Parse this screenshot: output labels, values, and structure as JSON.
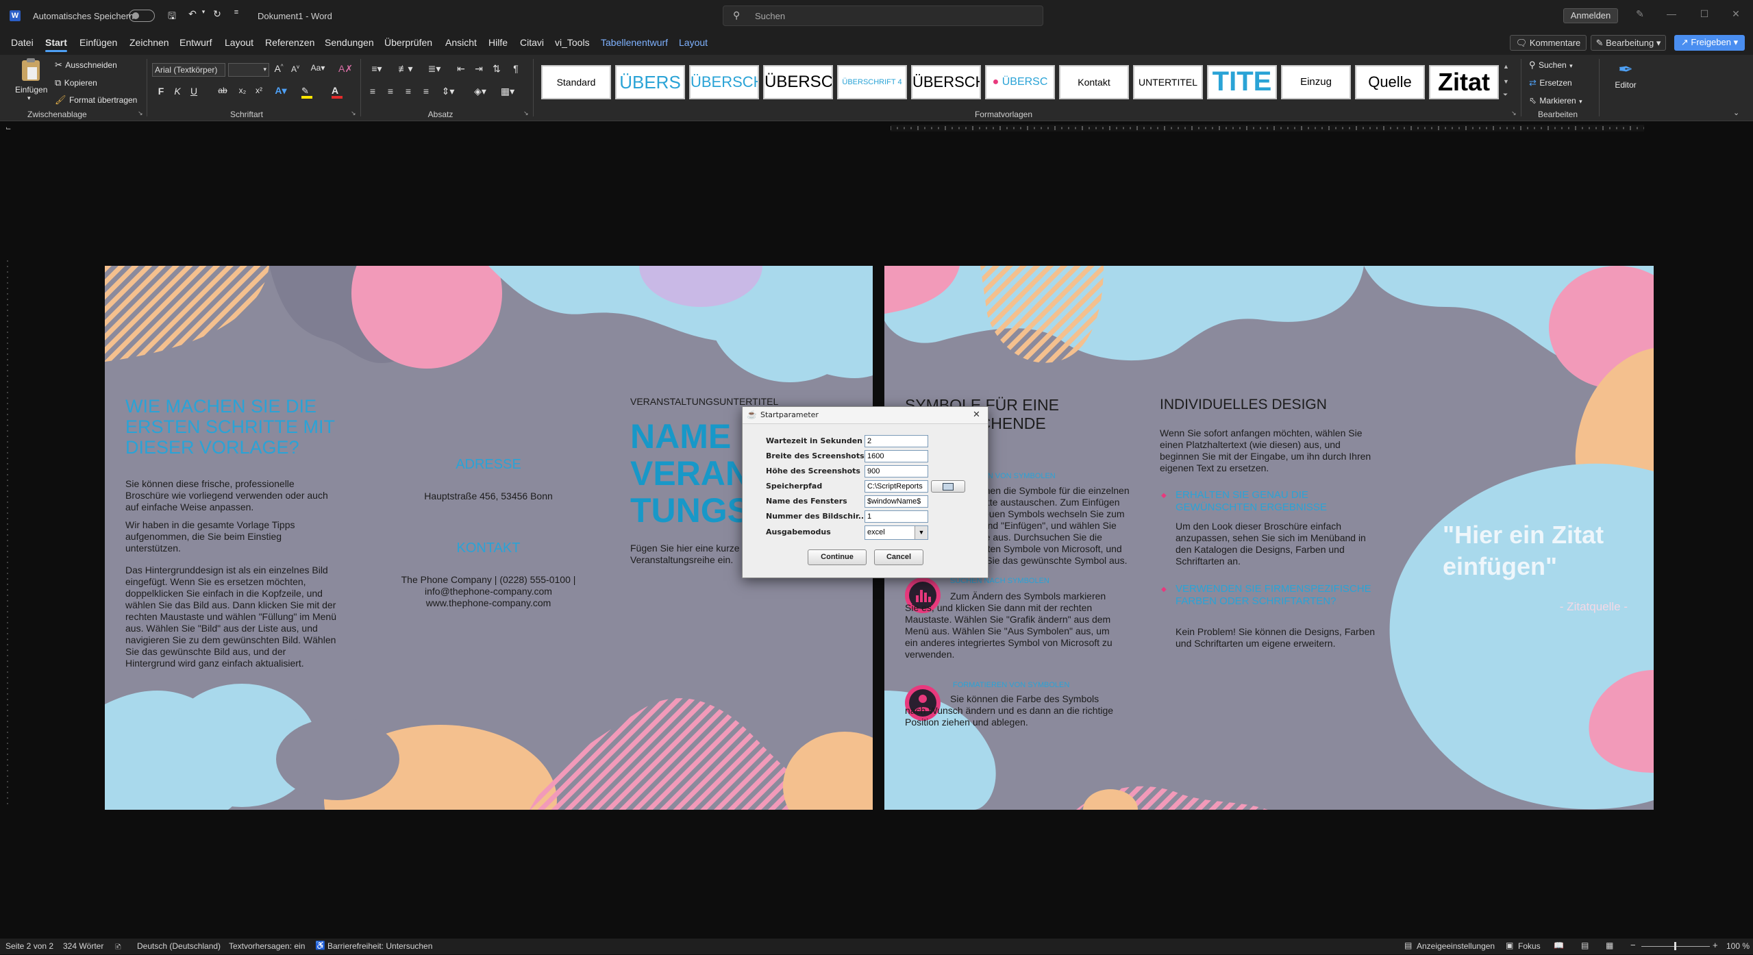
{
  "titlebar": {
    "autosave_label": "Automatisches Speichern",
    "doc_title": "Dokument1 - Word",
    "search_placeholder": "Suchen",
    "signin_label": "Anmelden",
    "minimize": "—",
    "restore": "☐",
    "close": "✕"
  },
  "tabs": [
    "Datei",
    "Start",
    "Einfügen",
    "Zeichnen",
    "Entwurf",
    "Layout",
    "Referenzen",
    "Sendungen",
    "Überprüfen",
    "Ansicht",
    "Hilfe",
    "Citavi",
    "vi_Tools",
    "Tabellenentwurf",
    "Layout"
  ],
  "tab_actions": {
    "comments": "Kommentare",
    "editing": "Bearbeitung",
    "share": "Freigeben"
  },
  "ribbon": {
    "clipboard": {
      "paste": "Einfügen",
      "cut": "Ausschneiden",
      "copy": "Kopieren",
      "format_painter": "Format übertragen",
      "group": "Zwischenablage"
    },
    "font": {
      "name": "Arial (Textkörper)",
      "size": "",
      "group": "Schriftart"
    },
    "paragraph": {
      "group": "Absatz"
    },
    "styles": {
      "group": "Formatvorlagen",
      "items": [
        "Standard",
        "ÜBERS",
        "ÜBERSCH",
        "ÜBERSC",
        "ÜBERSCHRIFT 4",
        "ÜBERSCH",
        "ÜBERSC",
        "Kontakt",
        "UNTERTITEL",
        "TITE",
        "Einzug",
        "Quelle",
        "Zitat"
      ]
    },
    "edit": {
      "find": "Suchen",
      "replace": "Ersetzen",
      "select": "Markieren",
      "group": "Bearbeiten"
    },
    "editor": {
      "label": "Editor"
    },
    "font_buttons": {
      "bold": "F",
      "italic": "K",
      "underline": "U",
      "strike": "ab",
      "subscript": "x₂",
      "superscript": "x²"
    }
  },
  "page1": {
    "heading": "WIE MACHEN SIE DIE ERSTEN SCHRITTE MIT DIESER VORLAGE?",
    "p1": "Sie können diese frische, professionelle Broschüre wie vorliegend verwenden oder auch auf einfache Weise anpassen.",
    "p2": "Wir haben in die gesamte Vorlage Tipps aufgenommen, die Sie beim Einstieg unterstützen.",
    "p3": "Das Hintergrunddesign ist als ein einzelnes Bild eingefügt. Wenn Sie es ersetzen möchten, doppelklicken Sie einfach in die Kopfzeile, und wählen Sie das Bild aus. Dann klicken Sie mit der rechten Maustaste und wählen \"Füllung\" im Menü aus. Wählen Sie \"Bild\" aus der Liste aus, und navigieren Sie zu dem gewünschten Bild. Wählen Sie das gewünschte Bild aus, und der Hintergrund wird ganz einfach aktualisiert.",
    "address_heading": "ADRESSE",
    "address": "Hauptstraße 456, 53456 Bonn",
    "contact_heading": "KONTAKT",
    "contact_line1": "The Phone Company | (0228) 555-0100 |",
    "contact_line2": "info@thephone-company.com",
    "contact_line3": "www.thephone-company.com",
    "event_subtitle": "VERANSTALTUNGSUNTERTITEL",
    "event_title_1": "NAME D",
    "event_title_2": "VERAN",
    "event_title_3": "TUNGS",
    "event_desc": "Fügen Sie hier eine kurze Beschreibung Ihrer Veranstaltungsreihe ein."
  },
  "page2": {
    "col1_heading": "SYMBOLE FÜR EINE ENTSPRECHENDE WIRKUNG",
    "replace_heading": "ERSETZEN VON SYMBOLEN",
    "replace_text": "Sie können die Symbole für die einzelnen Abschnitte austauschen. Zum Einfügen eines neuen Symbols wechseln Sie zum Menüband \"Einfügen\", und wählen Sie Symbole aus. Durchsuchen Sie die integrierten Symbole von Microsoft, und wählen Sie das gewünschte Symbol aus.",
    "search_heading": "SUCHEN NACH SYMBOLEN",
    "search_text": "Zum Ändern des Symbols markieren Sie es, und klicken Sie dann mit der rechten Maustaste. Wählen Sie \"Grafik ändern\" aus dem Menü aus. Wählen Sie \"Aus Symbolen\" aus, um ein anderes integriertes Symbol von Microsoft zu verwenden.",
    "format_heading": "FORMATIEREN VON SYMBOLEN",
    "format_text": "Sie können die Farbe des Symbols nach Wunsch ändern und es dann an die richtige Position ziehen und ablegen.",
    "col2_heading": "INDIVIDUELLES DESIGN",
    "col2_intro": "Wenn Sie sofort anfangen möchten, wählen Sie einen Platzhaltertext (wie diesen) aus, und beginnen Sie mit der Eingabe, um ihn durch Ihren eigenen Text zu ersetzen.",
    "bullet1_heading": "ERHALTEN SIE GENAU DIE GEWÜNSCHTEN ERGEBNISSE",
    "bullet1_text": "Um den Look dieser Broschüre einfach anzupassen, sehen Sie sich im Menüband in den Katalogen die Designs, Farben und Schriftarten an.",
    "bullet2_heading": "VERWENDEN SIE FIRMENSPEZIFISCHE FARBEN ODER SCHRIFTARTEN?",
    "bullet2_text": "Kein Problem! Sie können die Designs, Farben und Schriftarten um eigene erweitern.",
    "quote": "\"Hier ein Zitat einfügen\"",
    "quote_source": "- Zitatquelle -"
  },
  "dialog": {
    "title": "Startparameter",
    "fields": [
      {
        "label": "Wartezeit in Sekunden",
        "value": "2"
      },
      {
        "label": "Breite des Screenshots",
        "value": "1600"
      },
      {
        "label": "Höhe des Screenshots",
        "value": "900"
      },
      {
        "label": "Speicherpfad",
        "value": "C:\\ScriptReports"
      },
      {
        "label": "Name des Fensters",
        "value": "$windowName$"
      },
      {
        "label": "Nummer des Bildschir...",
        "value": "1"
      },
      {
        "label": "Ausgabemodus",
        "value": "excel"
      }
    ],
    "continue": "Continue",
    "cancel": "Cancel"
  },
  "statusbar": {
    "page": "Seite 2 von 2",
    "words": "324 Wörter",
    "language": "Deutsch (Deutschland)",
    "predictions": "Textvorhersagen: ein",
    "accessibility": "Barrierefreiheit: Untersuchen",
    "display_settings": "Anzeigeeinstellungen",
    "focus": "Fokus",
    "zoom": "100 %"
  },
  "colors": {
    "accent_blue": "#2aa3d6",
    "page_bg": "#8b8a9c",
    "pink": "#f29ab9",
    "light_blue": "#a9d9ec",
    "peach": "#f4c08e",
    "magenta": "#e8397d"
  }
}
